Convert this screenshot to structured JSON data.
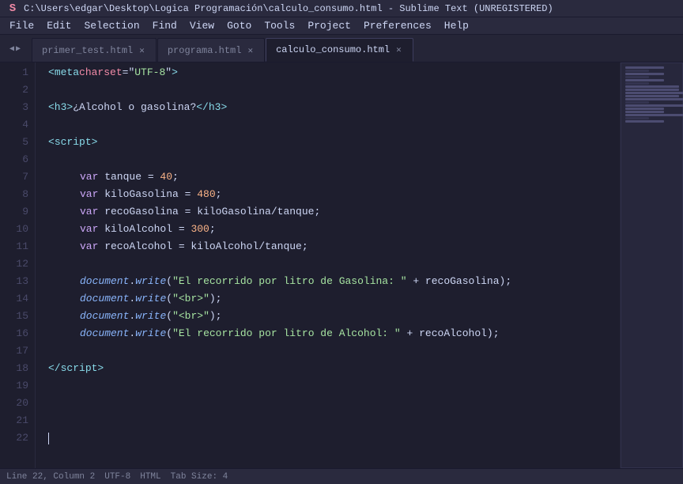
{
  "titleBar": {
    "title": "C:\\Users\\edgar\\Desktop\\Logica Programación\\calculo_consumo.html - Sublime Text (UNREGISTERED)",
    "logo": "S"
  },
  "menuBar": {
    "items": [
      "File",
      "Edit",
      "Selection",
      "Find",
      "View",
      "Goto",
      "Tools",
      "Project",
      "Preferences",
      "Help"
    ]
  },
  "tabs": [
    {
      "label": "primer_test.html",
      "active": false
    },
    {
      "label": "programa.html",
      "active": false
    },
    {
      "label": "calculo_consumo.html",
      "active": true
    }
  ],
  "tabNav": {
    "prev": "◀",
    "next": "▶"
  },
  "statusBar": {
    "position": "Line 22, Column 2",
    "encoding": "UTF-8",
    "syntax": "HTML",
    "tab": "Tab Size: 4"
  }
}
